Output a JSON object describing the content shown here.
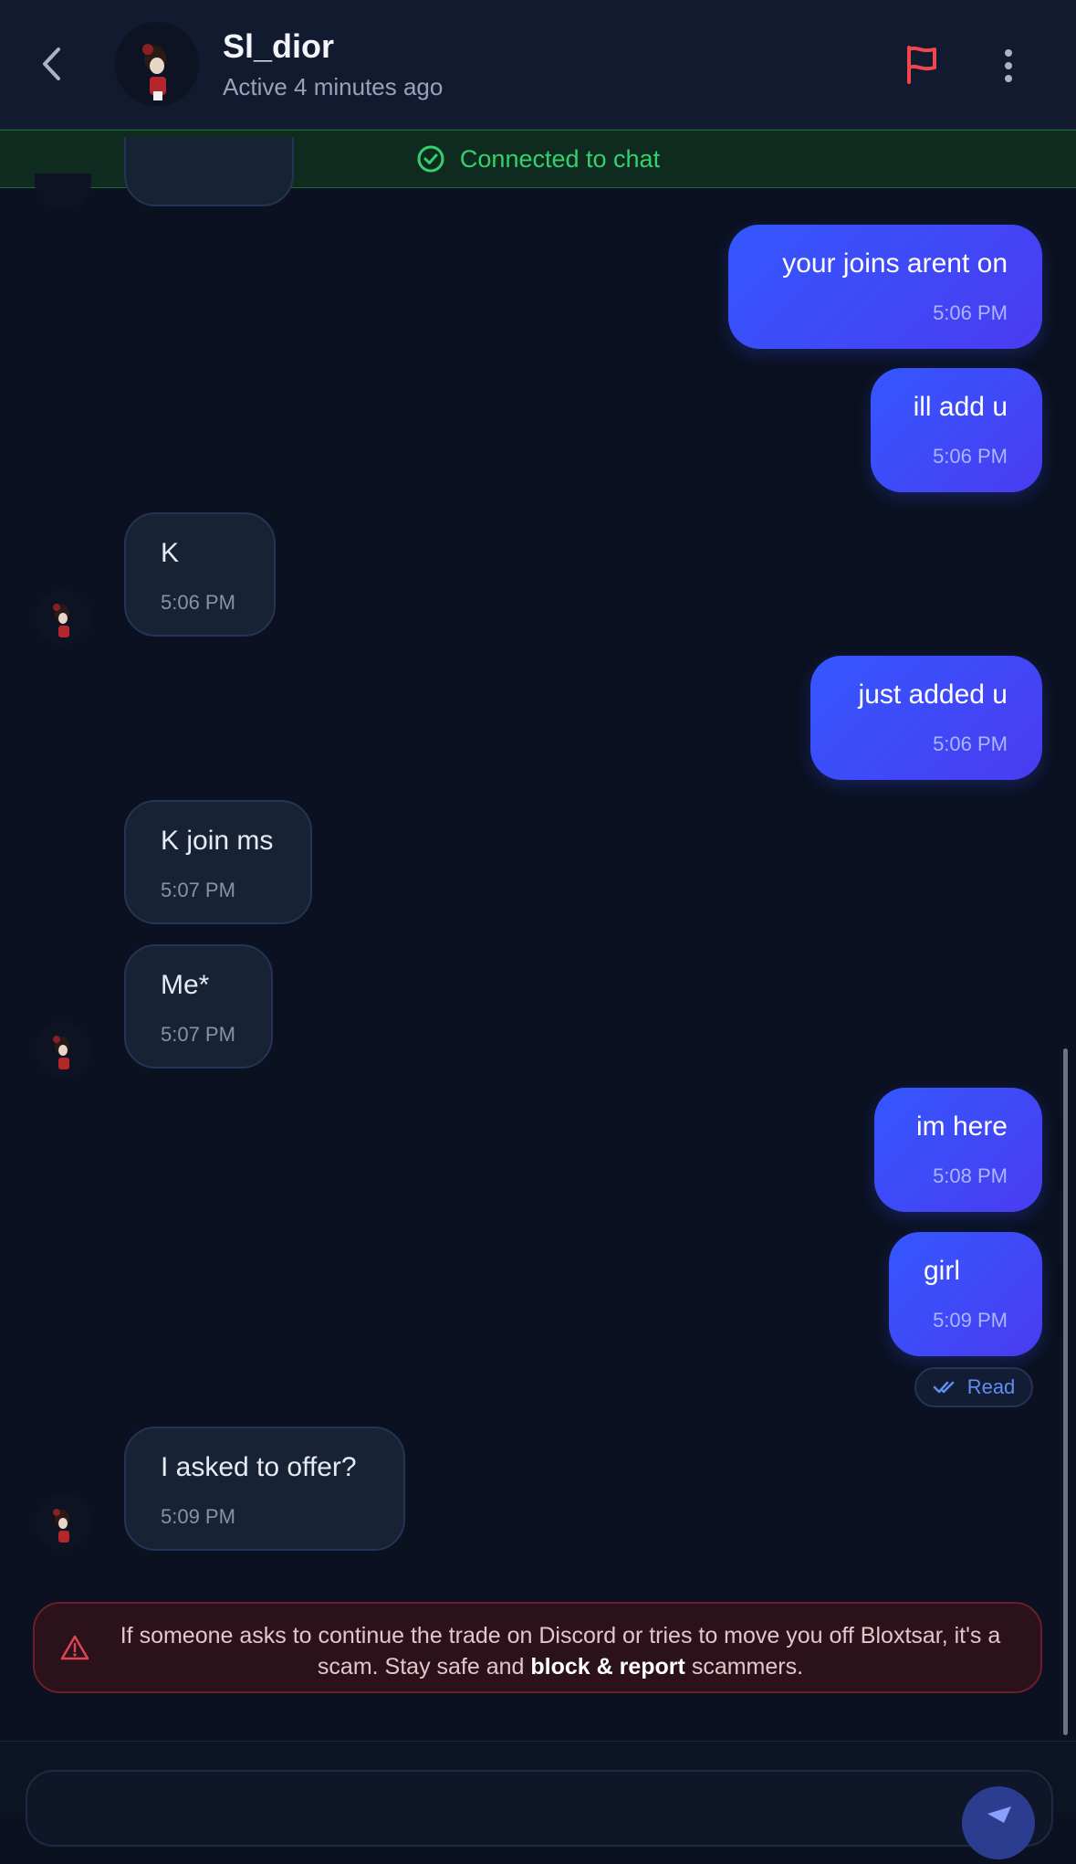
{
  "header": {
    "username": "Sl_dior",
    "status": "Active 4 minutes ago"
  },
  "banner": {
    "text": "Connected to chat"
  },
  "messages": [
    {
      "text": "your joins arent on",
      "time": "5:06 PM",
      "direction": "outgoing"
    },
    {
      "text": "ill add u",
      "time": "5:06 PM",
      "direction": "outgoing"
    },
    {
      "text": "K",
      "time": "5:06 PM",
      "direction": "incoming"
    },
    {
      "text": "just added u",
      "time": "5:06 PM",
      "direction": "outgoing"
    },
    {
      "text": "K join ms",
      "time": "5:07 PM",
      "direction": "incoming"
    },
    {
      "text": "Me*",
      "time": "5:07 PM",
      "direction": "incoming"
    },
    {
      "text": "im here",
      "time": "5:08 PM",
      "direction": "outgoing"
    },
    {
      "text": "girl",
      "time": "5:09 PM",
      "direction": "outgoing"
    },
    {
      "text": "I asked to offer?",
      "time": "5:09 PM",
      "direction": "incoming"
    }
  ],
  "read_receipt": "Read",
  "warning": {
    "text_before": "If someone asks to continue the trade on Discord or tries to move you off Bloxtsar, it's a scam. Stay safe and",
    "bold": "block & report",
    "text_after": "scammers."
  },
  "colors": {
    "background": "#0b1120",
    "outgoing_bubble": "#3457ff",
    "incoming_bubble": "#182235",
    "connected_green": "#35d06e",
    "flag_red": "#f0474f",
    "warning_red": "#e04552",
    "read_blue": "#5f8ef5"
  },
  "icons": [
    "back-chevron-icon",
    "flag-icon",
    "more-vertical-icon",
    "check-circle-icon",
    "double-check-icon",
    "warning-triangle-icon",
    "send-icon"
  ]
}
